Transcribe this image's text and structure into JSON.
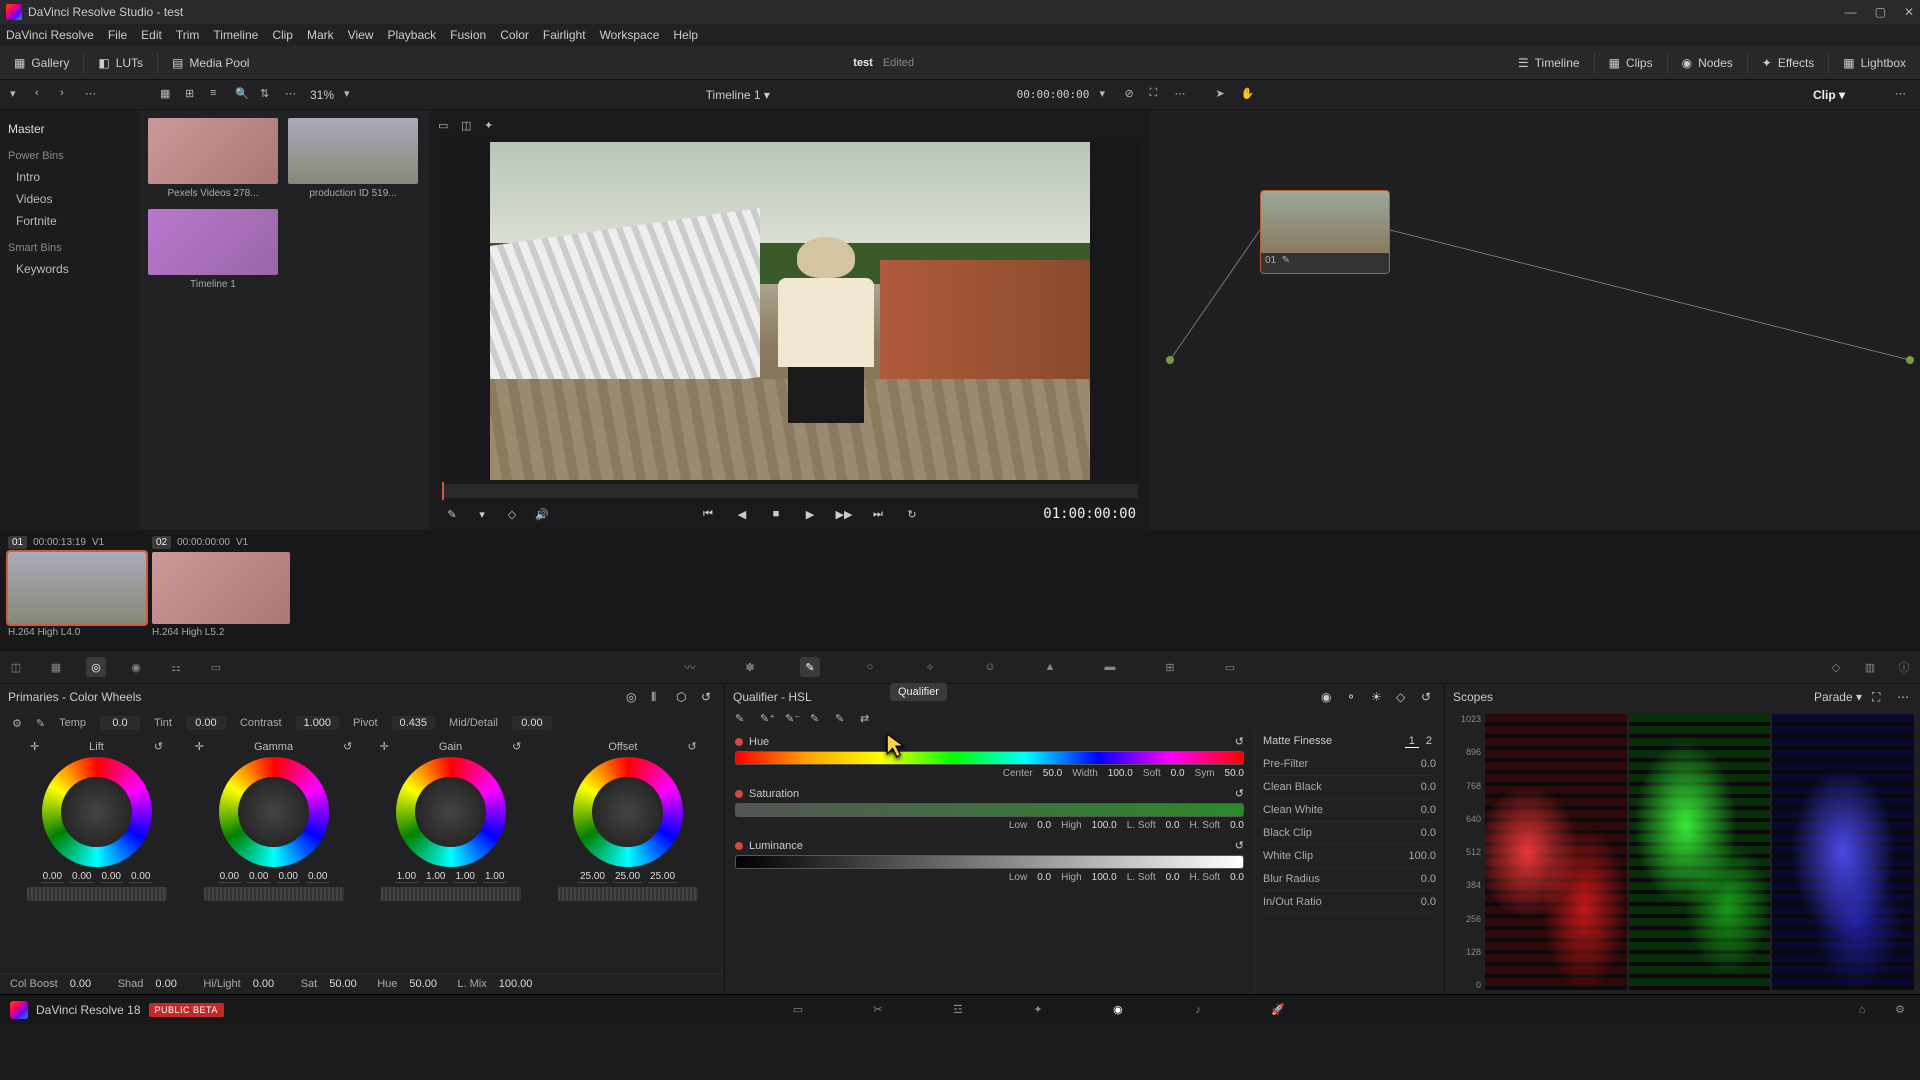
{
  "app": {
    "title": "DaVinci Resolve Studio - test"
  },
  "menu": [
    "DaVinci Resolve",
    "File",
    "Edit",
    "Trim",
    "Timeline",
    "Clip",
    "Mark",
    "View",
    "Playback",
    "Fusion",
    "Color",
    "Fairlight",
    "Workspace",
    "Help"
  ],
  "toptool": {
    "gallery": "Gallery",
    "luts": "LUTs",
    "mediapool": "Media Pool",
    "project": "test",
    "edited": "Edited",
    "timeline": "Timeline",
    "clips": "Clips",
    "nodes": "Nodes",
    "effects": "Effects",
    "lightbox": "Lightbox"
  },
  "secondbar": {
    "zoom": "31%",
    "timeline_name": "Timeline 1",
    "tc": "00:00:00:00",
    "clipmode": "Clip"
  },
  "bins": {
    "master": "Master",
    "powerbins": "Power Bins",
    "powerbins_items": [
      "Intro",
      "Videos",
      "Fortnite"
    ],
    "smartbins": "Smart Bins",
    "smartbins_items": [
      "Keywords"
    ]
  },
  "thumbs": [
    {
      "label": "Pexels Videos 278..."
    },
    {
      "label": "production ID 519..."
    },
    {
      "label": "Timeline 1"
    }
  ],
  "viewer": {
    "tc": "01:00:00:00"
  },
  "node": {
    "label": "01"
  },
  "clips": [
    {
      "n": "01",
      "tc": "00:00:13:19",
      "track": "V1",
      "codec": "H.264 High L4.0",
      "sel": true
    },
    {
      "n": "02",
      "tc": "00:00:00:00",
      "track": "V1",
      "codec": "H.264 High L5.2",
      "sel": false
    }
  ],
  "tooltip": "Qualifier",
  "primaries": {
    "title": "Primaries - Color Wheels",
    "row1": {
      "temp_l": "Temp",
      "temp": "0.0",
      "tint_l": "Tint",
      "tint": "0.00",
      "contrast_l": "Contrast",
      "contrast": "1.000",
      "pivot_l": "Pivot",
      "pivot": "0.435",
      "md_l": "Mid/Detail",
      "md": "0.00"
    },
    "wheels": [
      {
        "name": "Lift",
        "vals": [
          "0.00",
          "0.00",
          "0.00",
          "0.00"
        ]
      },
      {
        "name": "Gamma",
        "vals": [
          "0.00",
          "0.00",
          "0.00",
          "0.00"
        ]
      },
      {
        "name": "Gain",
        "vals": [
          "1.00",
          "1.00",
          "1.00",
          "1.00"
        ]
      },
      {
        "name": "Offset",
        "vals": [
          "25.00",
          "25.00",
          "25.00"
        ]
      }
    ],
    "row2": {
      "cb_l": "Col Boost",
      "cb": "0.00",
      "shad_l": "Shad",
      "shad": "0.00",
      "hl_l": "Hi/Light",
      "hl": "0.00",
      "sat_l": "Sat",
      "sat": "50.00",
      "hue_l": "Hue",
      "hue": "50.00",
      "lmix_l": "L. Mix",
      "lmix": "100.00"
    }
  },
  "qualifier": {
    "title": "Qualifier - HSL",
    "hue": {
      "label": "Hue",
      "center_l": "Center",
      "center": "50.0",
      "width_l": "Width",
      "width": "100.0",
      "soft_l": "Soft",
      "soft": "0.0",
      "sym_l": "Sym",
      "sym": "50.0"
    },
    "sat": {
      "label": "Saturation",
      "low_l": "Low",
      "low": "0.0",
      "high_l": "High",
      "high": "100.0",
      "ls_l": "L. Soft",
      "ls": "0.0",
      "hs_l": "H. Soft",
      "hs": "0.0"
    },
    "lum": {
      "label": "Luminance",
      "low_l": "Low",
      "low": "0.0",
      "high_l": "High",
      "high": "100.0",
      "ls_l": "L. Soft",
      "ls": "0.0",
      "hs_l": "H. Soft",
      "hs": "0.0"
    },
    "matte": {
      "title": "Matte Finesse",
      "tab1": "1",
      "tab2": "2",
      "rows": [
        {
          "l": "Pre-Filter",
          "v": "0.0"
        },
        {
          "l": "Clean Black",
          "v": "0.0"
        },
        {
          "l": "Clean White",
          "v": "0.0"
        },
        {
          "l": "Black Clip",
          "v": "0.0"
        },
        {
          "l": "White Clip",
          "v": "100.0"
        },
        {
          "l": "Blur Radius",
          "v": "0.0"
        },
        {
          "l": "In/Out Ratio",
          "v": "0.0"
        }
      ]
    }
  },
  "scopes": {
    "title": "Scopes",
    "mode": "Parade",
    "scale": [
      "1023",
      "896",
      "768",
      "640",
      "512",
      "384",
      "256",
      "128",
      "0"
    ]
  },
  "pagebar": {
    "brand": "DaVinci Resolve 18",
    "beta": "PUBLIC BETA"
  }
}
